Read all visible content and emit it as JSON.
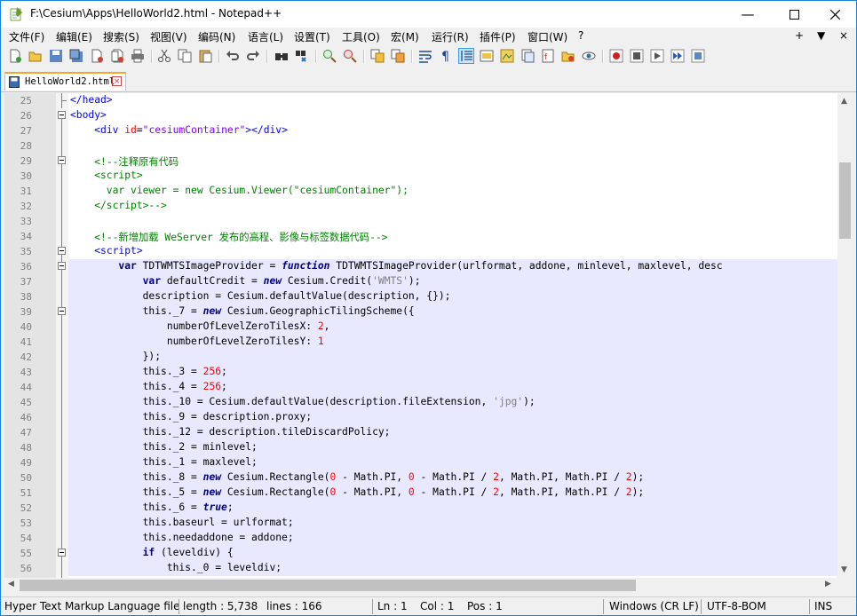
{
  "window": {
    "title": "F:\\Cesium\\Apps\\HelloWorld2.html - Notepad++"
  },
  "menu": {
    "items": [
      "文件(F)",
      "编辑(E)",
      "搜索(S)",
      "视图(V)",
      "编码(N)",
      "语言(L)",
      "设置(T)",
      "工具(O)",
      "宏(M)",
      "运行(R)",
      "插件(P)",
      "窗口(W)",
      "?"
    ],
    "right": [
      "+",
      "▼",
      "×"
    ]
  },
  "tab": {
    "label": "HelloWorld2.html"
  },
  "editor": {
    "lines": [
      {
        "n": "25",
        "html": "<span style='color:#0000ff'>&lt;/head&gt;</span>"
      },
      {
        "n": "26",
        "html": "<span style='color:#0000ff'>&lt;body&gt;</span>"
      },
      {
        "n": "27",
        "html": "    <span style='color:#0000ff'>&lt;div</span> <span style='color:#ff0000'>id</span>=<span style='color:#8000ff'>\"cesiumContainer\"</span><span style='color:#0000ff'>&gt;&lt;/div&gt;</span>"
      },
      {
        "n": "28",
        "html": ""
      },
      {
        "n": "29",
        "html": "    <span style='color:#008000'>&lt;!--注释原有代码</span>"
      },
      {
        "n": "30",
        "html": "<span style='color:#008000'>    &lt;script&gt;</span>"
      },
      {
        "n": "31",
        "html": "<span style='color:#008000'>      var viewer = new Cesium.Viewer(\"cesiumContainer\");</span>"
      },
      {
        "n": "32",
        "html": "<span style='color:#008000'>    &lt;/script&gt;--&gt;</span>"
      },
      {
        "n": "33",
        "html": ""
      },
      {
        "n": "34",
        "html": "    <span style='color:#008000'>&lt;!--新增加载 WeServer 发布的高程、影像与标签数据代码--&gt;</span>"
      },
      {
        "n": "35",
        "html": "    <span style='color:#0000ff'>&lt;script&gt;</span>"
      },
      {
        "n": "36",
        "html": "        <span style='color:#000080;font-weight:bold'>var</span> TDTWMTSImageProvider = <span style='color:#000080;font-weight:bold;font-style:italic'>function</span> TDTWMTSImageProvider(urlformat, addone, minlevel, maxlevel, desc"
      },
      {
        "n": "37",
        "html": "            <span style='color:#000080;font-weight:bold'>var</span> defaultCredit = <span style='color:#000080;font-weight:bold;font-style:italic'>new</span> Cesium.Credit(<span style='color:#808080'>'WMTS'</span>);"
      },
      {
        "n": "38",
        "html": "            description = Cesium.defaultValue(description, {});"
      },
      {
        "n": "39",
        "html": "            this._7 = <span style='color:#000080;font-weight:bold;font-style:italic'>new</span> Cesium.GeographicTilingScheme({"
      },
      {
        "n": "40",
        "html": "                numberOfLevelZeroTilesX: <span style='color:#ff0000'>2</span>,"
      },
      {
        "n": "41",
        "html": "                numberOfLevelZeroTilesY: <span style='color:#ff0000'>1</span>"
      },
      {
        "n": "42",
        "html": "            });"
      },
      {
        "n": "43",
        "html": "            this._3 = <span style='color:#ff0000'>256</span>;"
      },
      {
        "n": "44",
        "html": "            this._4 = <span style='color:#ff0000'>256</span>;"
      },
      {
        "n": "45",
        "html": "            this._10 = Cesium.defaultValue(description.fileExtension, <span style='color:#808080'>'jpg'</span>);"
      },
      {
        "n": "46",
        "html": "            this._9 = description.proxy;"
      },
      {
        "n": "47",
        "html": "            this._12 = description.tileDiscardPolicy;"
      },
      {
        "n": "48",
        "html": "            this._2 = minlevel;"
      },
      {
        "n": "49",
        "html": "            this._1 = maxlevel;"
      },
      {
        "n": "50",
        "html": "            this._8 = <span style='color:#000080;font-weight:bold;font-style:italic'>new</span> Cesium.Rectangle(<span style='color:#ff0000'>0</span> - Math.PI, <span style='color:#ff0000'>0</span> - Math.PI / <span style='color:#ff0000'>2</span>, Math.PI, Math.PI / <span style='color:#ff0000'>2</span>);"
      },
      {
        "n": "51",
        "html": "            this._5 = <span style='color:#000080;font-weight:bold;font-style:italic'>new</span> Cesium.Rectangle(<span style='color:#ff0000'>0</span> - Math.PI, <span style='color:#ff0000'>0</span> - Math.PI / <span style='color:#ff0000'>2</span>, Math.PI, Math.PI / <span style='color:#ff0000'>2</span>);"
      },
      {
        "n": "52",
        "html": "            this._6 = <span style='color:#000080;font-weight:bold;font-style:italic'>true</span>;"
      },
      {
        "n": "53",
        "html": "            this.baseurl = urlformat;"
      },
      {
        "n": "54",
        "html": "            this.needaddone = addone;"
      },
      {
        "n": "55",
        "html": "            <span style='color:#000080;font-weight:bold'>if</span> (leveldiv) {"
      },
      {
        "n": "56",
        "html": "                this._0 = leveldiv;"
      }
    ]
  },
  "status": {
    "file_type": "Hyper Text Markup Language file",
    "length": "length : 5,738",
    "lines": "lines : 166",
    "ln": "Ln : 1",
    "col": "Col : 1",
    "pos": "Pos : 1",
    "eol": "Windows (CR LF)",
    "encoding": "UTF-8-BOM",
    "mode": "INS"
  }
}
